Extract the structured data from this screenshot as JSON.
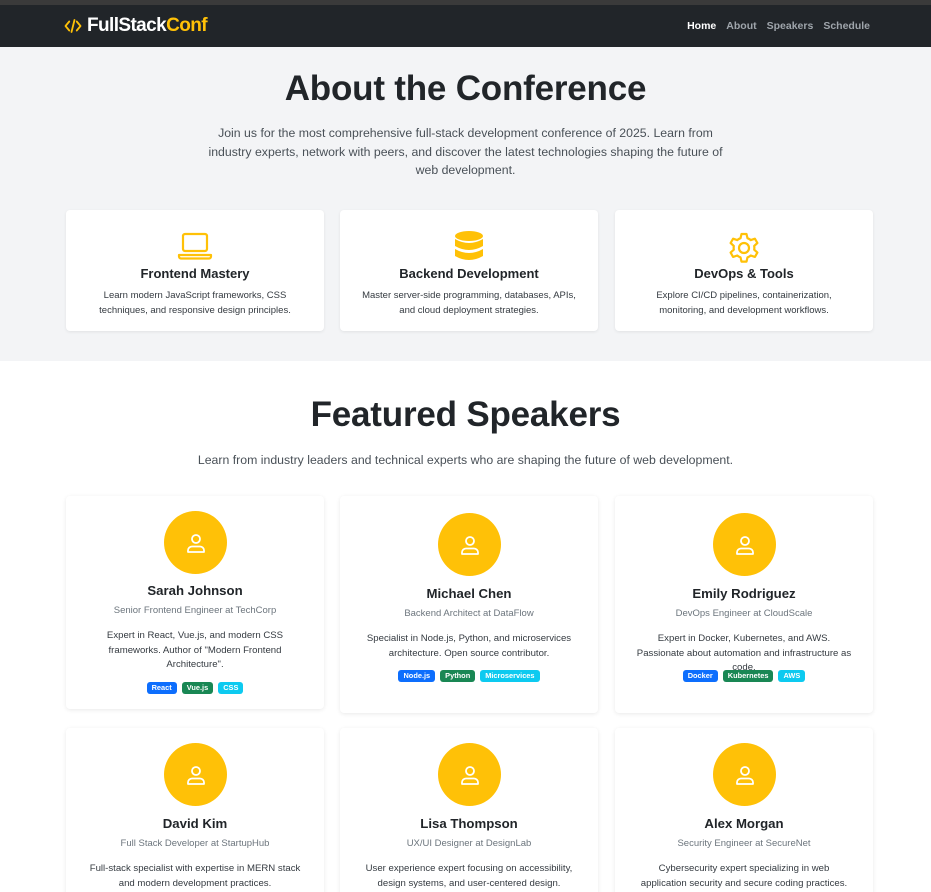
{
  "nav": {
    "brand_part1": "FullStack",
    "brand_part2": "Conf",
    "brand_icon": "code-icon",
    "links": [
      "Home",
      "About",
      "Speakers",
      "Schedule"
    ],
    "active": "Home"
  },
  "about": {
    "title": "About the Conference",
    "lead": "Join us for the most comprehensive full-stack development conference of 2025. Learn from industry experts, network with peers, and discover the latest technologies shaping the future of web development.",
    "features": [
      {
        "icon": "laptop-icon",
        "title": "Frontend Mastery",
        "desc": "Learn modern JavaScript frameworks, CSS techniques, and responsive design principles."
      },
      {
        "icon": "database-icon",
        "title": "Backend Development",
        "desc": "Master server-side programming, databases, APIs, and cloud deployment strategies."
      },
      {
        "icon": "gear-icon",
        "title": "DevOps & Tools",
        "desc": "Explore CI/CD pipelines, containerization, monitoring, and development workflows."
      }
    ]
  },
  "speakers": {
    "title": "Featured Speakers",
    "lead": "Learn from industry leaders and technical experts who are shaping the future of web development.",
    "items": [
      {
        "name": "Sarah Johnson",
        "role": "Senior Frontend Engineer at TechCorp",
        "bio": "Expert in React, Vue.js, and modern CSS frameworks. Author of \"Modern Frontend Architecture\".",
        "tags": [
          "React",
          "Vue.js",
          "CSS"
        ]
      },
      {
        "name": "Michael Chen",
        "role": "Backend Architect at DataFlow",
        "bio": "Specialist in Node.js, Python, and microservices architecture. Open source contributor.",
        "tags": [
          "Node.js",
          "Python",
          "Microservices"
        ]
      },
      {
        "name": "Emily Rodriguez",
        "role": "DevOps Engineer at CloudScale",
        "bio": "Expert in Docker, Kubernetes, and AWS. Passionate about automation and infrastructure as code.",
        "tags": [
          "Docker",
          "Kubernetes",
          "AWS"
        ]
      },
      {
        "name": "David Kim",
        "role": "Full Stack Developer at StartupHub",
        "bio": "Full-stack specialist with expertise in MERN stack and modern development practices.",
        "tags": []
      },
      {
        "name": "Lisa Thompson",
        "role": "UX/UI Designer at DesignLab",
        "bio": "User experience expert focusing on accessibility, design systems, and user-centered design.",
        "tags": []
      },
      {
        "name": "Alex Morgan",
        "role": "Security Engineer at SecureNet",
        "bio": "Cybersecurity expert specializing in web application security and secure coding practices.",
        "tags": []
      }
    ]
  },
  "colors": {
    "accent": "#ffc107",
    "navbar": "#212529",
    "tag_blue": "#0d6efd",
    "tag_green": "#198754",
    "tag_cyan": "#0dcaf0"
  }
}
